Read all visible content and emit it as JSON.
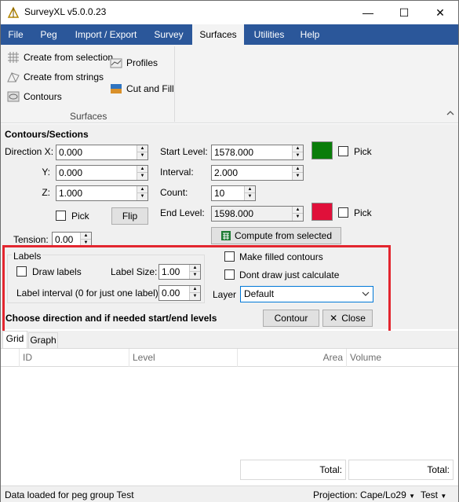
{
  "window": {
    "title": "SurveyXL v5.0.0.23",
    "minimize": "—",
    "maximize": "☐",
    "close": "✕"
  },
  "menu": [
    "File",
    "Peg",
    "Import / Export",
    "Survey",
    "Surfaces",
    "Utilities",
    "Help"
  ],
  "ribbon": {
    "create_from_selection": "Create from selection",
    "create_from_strings": "Create from strings",
    "contours": "Contours",
    "profiles": "Profiles",
    "cut_and_fill": "Cut and Fill",
    "group_label": "Surfaces",
    "collapse": "^"
  },
  "form": {
    "section_title": "Contours/Sections",
    "direction_x_label": "Direction X:",
    "direction_x": "0.000",
    "y_label": "Y:",
    "y": "0.000",
    "z_label": "Z:",
    "z": "1.000",
    "pick_label": "Pick",
    "flip": "Flip",
    "tension_label": "Tension:",
    "tension": "0.00",
    "start_level_label": "Start Level:",
    "start_level": "1578.000",
    "interval_label": "Interval:",
    "interval": "2.000",
    "count_label": "Count:",
    "count": "10",
    "end_level_label": "End Level:",
    "end_level": "1598.000",
    "compute_from_selected": "Compute from selected",
    "start_color": "#0a7d0a",
    "end_color": "#e0103a"
  },
  "labels": {
    "group_title": "Labels",
    "draw_labels": "Draw labels",
    "label_size_label": "Label Size:",
    "label_size": "1.00",
    "label_interval_label": "Label interval (0 for just one label):",
    "label_interval": "0.00",
    "make_filled": "Make filled contours",
    "dont_draw": "Dont draw just calculate",
    "layer_label": "Layer",
    "layer_value": "Default",
    "instruction": "Choose direction and if needed start/end levels",
    "contour_btn": "Contour",
    "close_btn": "Close"
  },
  "tabs": [
    "Grid",
    "Graph"
  ],
  "grid": {
    "columns": [
      "ID",
      "Level",
      "Area",
      "Volume"
    ],
    "total_label": "Total:"
  },
  "status": {
    "message": "Data loaded for peg group Test",
    "projection": "Projection: Cape/Lo29",
    "group": "Test"
  }
}
